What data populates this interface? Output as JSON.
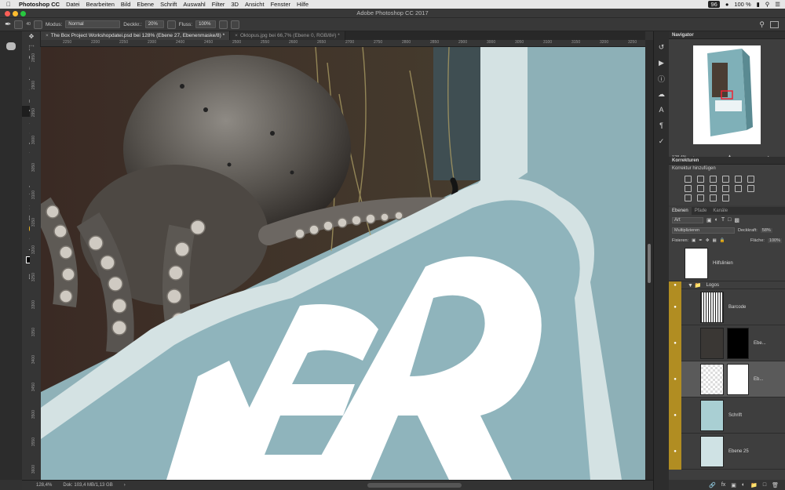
{
  "menubar": {
    "app_name": "Photoshop CC",
    "items": [
      "Datei",
      "Bearbeiten",
      "Bild",
      "Ebene",
      "Schrift",
      "Auswahl",
      "Filter",
      "3D",
      "Ansicht",
      "Fenster",
      "Hilfe"
    ],
    "battery": "100 %",
    "clock": "96"
  },
  "window": {
    "title": "Adobe Photoshop CC 2017"
  },
  "options": {
    "modus_label": "Modus:",
    "modus_value": "Normal",
    "deckr_label": "Deckkr.:",
    "deckr_value": "20%",
    "fluss_label": "Fluss:",
    "fluss_value": "100%",
    "brush_size": "40"
  },
  "tabs": [
    {
      "label": "The Box Project Workshopdatei.psd bei 128% (Ebene 27, Ebenenmaske/8) *",
      "active": true
    },
    {
      "label": "Oktopus.jpg bei 66,7% (Ebene 0, RGB/8#) *",
      "active": false
    }
  ],
  "ruler_h": [
    "2250",
    "2200",
    "2250",
    "2300",
    "2400",
    "2450",
    "2500",
    "2550",
    "2600",
    "2650",
    "2700",
    "2750",
    "2800",
    "2850",
    "2900",
    "3000",
    "3050",
    "3100",
    "3150",
    "3200",
    "3250"
  ],
  "ruler_v": [
    "2850",
    "2900",
    "2950",
    "3000",
    "3050",
    "3100",
    "3150",
    "3200",
    "3250",
    "3300",
    "3350",
    "3400",
    "3450",
    "3500",
    "3550",
    "3600"
  ],
  "status": {
    "zoom": "128,4%",
    "doc": "Dok: 103,4 MB/1,13 GB"
  },
  "panels": {
    "navigator_title": "Navigator",
    "navigator_zoom": "128,4%",
    "korrekturen_title": "Korrekturen",
    "korrekturen_subtitle": "Korrektur hinzufügen",
    "layer_tabs": [
      "Ebenen",
      "Pfade",
      "Kanäle"
    ],
    "filter_label": "Art",
    "blend_mode": "Multiplizieren",
    "opacity_label": "Deckkraft:",
    "opacity_value": "58%",
    "fixieren_label": "Fixieren:",
    "flaeche_label": "Fläche:",
    "flaeche_value": "100%",
    "layers": [
      {
        "name": "Hilfslinien",
        "visible": false,
        "group": false
      },
      {
        "name": "Logos",
        "visible": true,
        "group": true
      },
      {
        "name": "Barcode",
        "visible": true,
        "group": false
      },
      {
        "name": "Ebe...",
        "visible": true,
        "group": false
      },
      {
        "name": "Eb...",
        "visible": true,
        "group": false,
        "selected": true
      },
      {
        "name": "Schrift",
        "visible": true,
        "group": false
      },
      {
        "name": "Ebene 25",
        "visible": true,
        "group": false
      }
    ]
  },
  "canvas_text": "ER"
}
